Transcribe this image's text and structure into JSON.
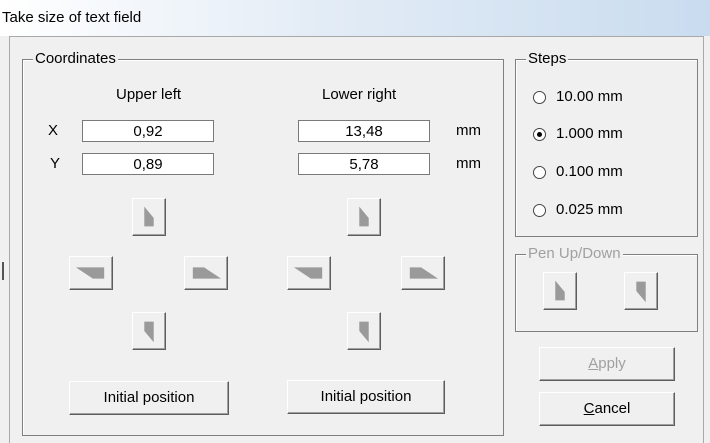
{
  "window": {
    "title": "Take size of text field"
  },
  "coordinates": {
    "group_label": "Coordinates",
    "upper_left_label": "Upper left",
    "lower_right_label": "Lower right",
    "x_label": "X",
    "y_label": "Y",
    "upper_left": {
      "x": "0,92",
      "y": "0,89"
    },
    "lower_right": {
      "x": "13,48",
      "y": "5,78"
    },
    "unit": "mm",
    "initial_position_label": "Initial position"
  },
  "steps": {
    "group_label": "Steps",
    "options": [
      "10.00 mm",
      "1.000 mm",
      "0.100 mm",
      "0.025 mm"
    ],
    "selected": "1.000 mm"
  },
  "pen": {
    "group_label": "Pen Up/Down"
  },
  "buttons": {
    "apply_mnemonic": "A",
    "apply_rest": "pply",
    "cancel_mnemonic": "C",
    "cancel_rest": "ancel"
  },
  "colors": {
    "arrow_fill": "#9a9a9a",
    "disabled_text": "#a0a0a0"
  }
}
